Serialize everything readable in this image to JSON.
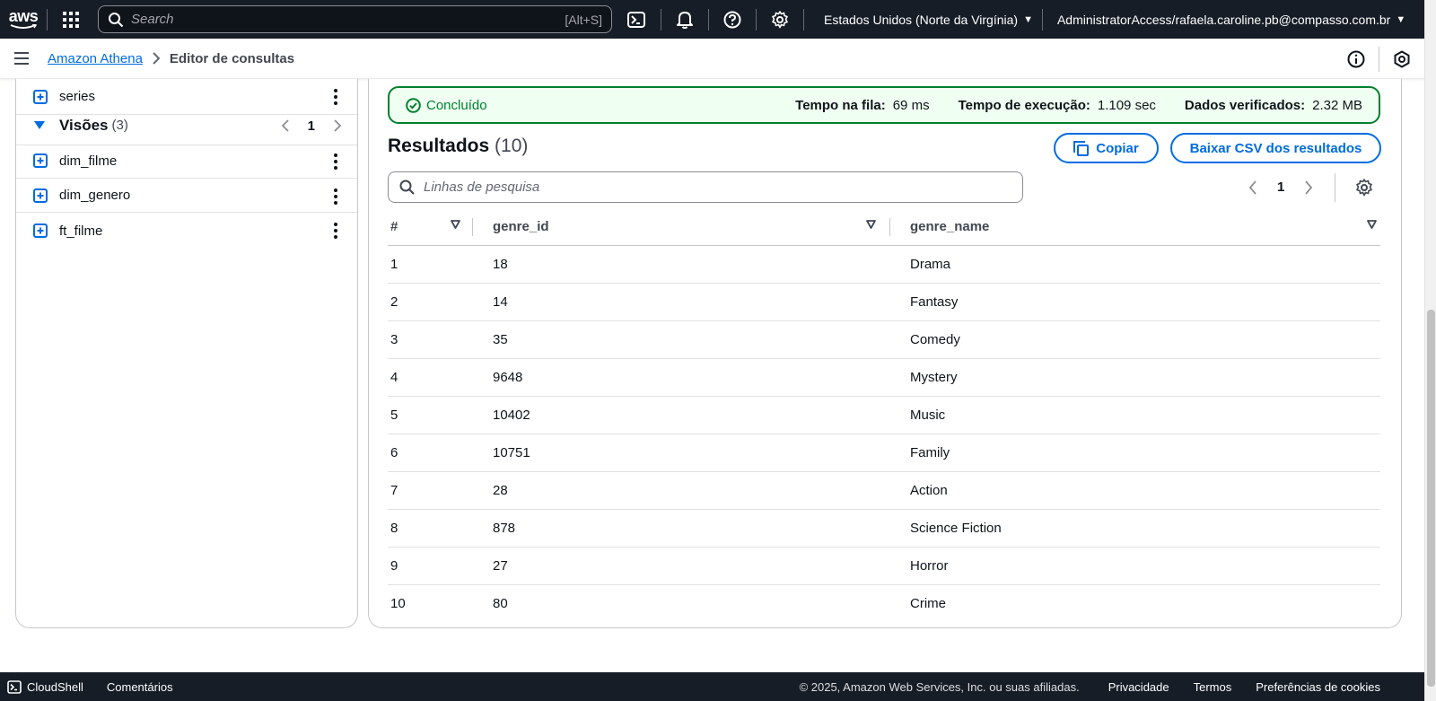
{
  "topnav": {
    "logo_text": "aws",
    "search_placeholder": "Search",
    "search_shortcut": "[Alt+S]",
    "region": "Estados Unidos (Norte da Virgínia)",
    "account": "AdministratorAccess/rafaela.caroline.pb@compasso.com.br"
  },
  "breadcrumb": {
    "service": "Amazon Athena",
    "current": "Editor de consultas"
  },
  "left_panel": {
    "tables_last_item": "series",
    "views": {
      "title": "Visões",
      "count": "(3)",
      "page": "1",
      "items": [
        "dim_filme",
        "dim_genero",
        "ft_filme"
      ]
    }
  },
  "status": {
    "label": "Concluído",
    "queue_label": "Tempo na fila:",
    "queue_value": "69 ms",
    "exec_label": "Tempo de execução:",
    "exec_value": "1.109 sec",
    "data_label": "Dados verificados:",
    "data_value": "2.32 MB"
  },
  "results": {
    "title": "Resultados",
    "count": "(10)",
    "copy_label": "Copiar",
    "csv_label": "Baixar CSV dos resultados",
    "search_placeholder": "Linhas de pesquisa",
    "page": "1",
    "columns": [
      "#",
      "genre_id",
      "genre_name"
    ],
    "rows": [
      [
        "1",
        "18",
        "Drama"
      ],
      [
        "2",
        "14",
        "Fantasy"
      ],
      [
        "3",
        "35",
        "Comedy"
      ],
      [
        "4",
        "9648",
        "Mystery"
      ],
      [
        "5",
        "10402",
        "Music"
      ],
      [
        "6",
        "10751",
        "Family"
      ],
      [
        "7",
        "28",
        "Action"
      ],
      [
        "8",
        "878",
        "Science Fiction"
      ],
      [
        "9",
        "27",
        "Horror"
      ],
      [
        "10",
        "80",
        "Crime"
      ]
    ]
  },
  "footer": {
    "cloudshell": "CloudShell",
    "feedback": "Comentários",
    "copyright": "© 2025, Amazon Web Services, Inc. ou suas afiliadas.",
    "privacy": "Privacidade",
    "terms": "Termos",
    "cookies": "Preferências de cookies"
  },
  "colors": {
    "nav_bg": "#161d26",
    "link_blue": "#006ce0",
    "success_green": "#00802f",
    "success_bg": "#effff1"
  }
}
